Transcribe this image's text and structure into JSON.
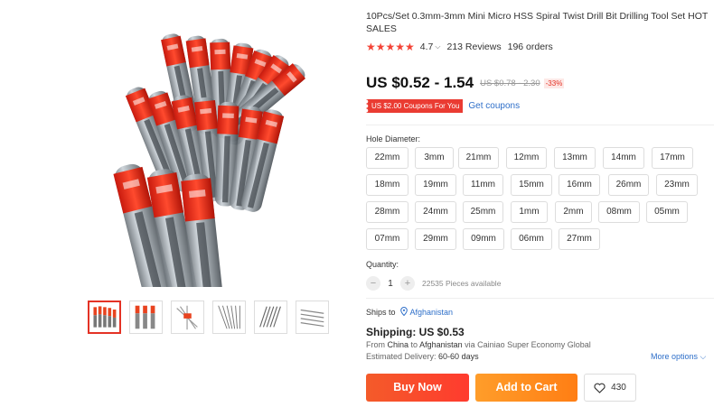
{
  "product": {
    "title": "10Pcs/Set 0.3mm-3mm Mini Micro HSS Spiral Twist Drill Bit Drilling Tool Set HOT SALES",
    "rating": "4.7",
    "stars": "★★★★★",
    "reviews": "213 Reviews",
    "orders": "196 orders"
  },
  "price": {
    "current": "US $0.52 - 1.54",
    "original": "US $0.78 - 2.30",
    "discount": "-33%"
  },
  "coupon": {
    "tag": "US $2.00 Coupons For You",
    "link": "Get coupons"
  },
  "hole_diameter": {
    "label": "Hole Diameter:",
    "options": [
      "22mm",
      "3mm",
      "21mm",
      "12mm",
      "13mm",
      "14mm",
      "17mm",
      "18mm",
      "19mm",
      "11mm",
      "15mm",
      "16mm",
      "26mm",
      "23mm",
      "28mm",
      "24mm",
      "25mm",
      "1mm",
      "2mm",
      "08mm",
      "05mm",
      "07mm",
      "29mm",
      "09mm",
      "06mm",
      "27mm"
    ]
  },
  "quantity": {
    "label": "Quantity:",
    "minus": "−",
    "value": "1",
    "plus": "+",
    "available": "22535 Pieces available"
  },
  "shipping": {
    "ships_to_label": "Ships to",
    "pin_icon": "📍",
    "country": "Afghanistan",
    "shipping_label": "Shipping: US $0.53",
    "from_prefix": "From",
    "from_country": "China",
    "to_word": "to",
    "to_country": "Afghanistan",
    "via": "via Cainiao Super Economy Global",
    "delivery_prefix": "Estimated Delivery:",
    "delivery_days": "60-60 days",
    "more_options": "More options ⌵"
  },
  "actions": {
    "buy_now": "Buy Now",
    "add_to_cart": "Add to Cart",
    "wishlist_count": "430"
  },
  "colors": {
    "accent_red": "#e43225",
    "buy_now": "#ff4a2b",
    "add_to_cart": "#ff8a1e",
    "link_blue": "#2e6fc9"
  }
}
